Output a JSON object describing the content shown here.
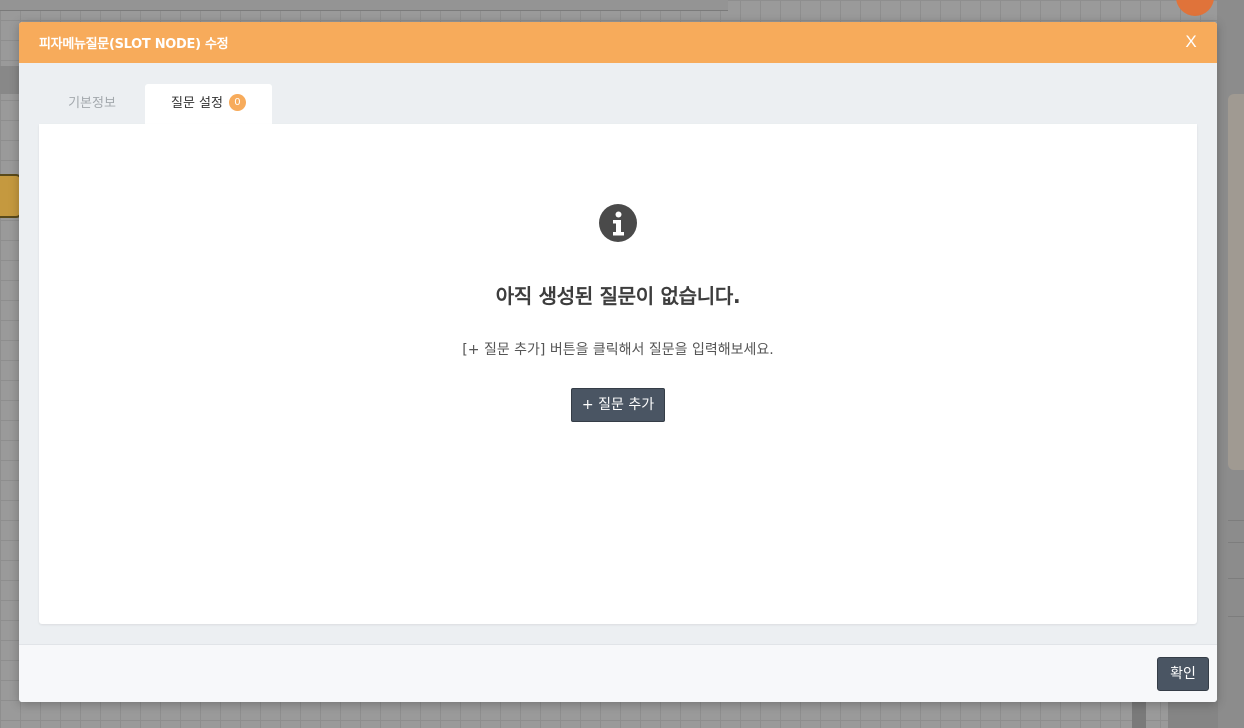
{
  "colors": {
    "header_bg": "#f7ab5b",
    "badge_bg": "#f7ab5b",
    "button_bg": "#4a5563",
    "modal_body_bg": "#eceff2"
  },
  "modal": {
    "title": "피자메뉴질문(SLOT NODE) 수정",
    "close_label": "X"
  },
  "tabs": [
    {
      "label": "기본정보",
      "active": false
    },
    {
      "label": "질문 설정",
      "active": true,
      "badge": "0"
    }
  ],
  "empty_state": {
    "icon": "info-circle-icon",
    "title": "아직 생성된 질문이 없습니다.",
    "description": "[+ 질문 추가] 버튼을 클릭해서 질문을 입력해보세요.",
    "add_button_label": "+ 질문 추가"
  },
  "footer": {
    "confirm_label": "확인"
  }
}
